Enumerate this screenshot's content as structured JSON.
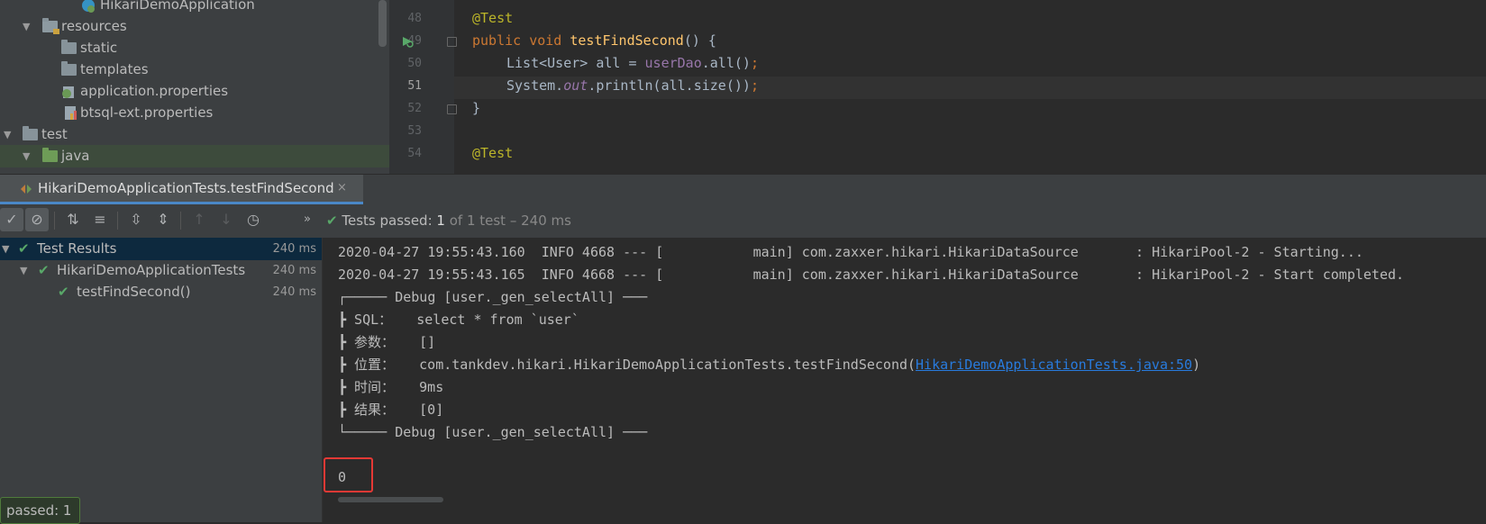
{
  "project_tree": {
    "items": [
      {
        "label": "HikariDemoApplication",
        "type": "class"
      },
      {
        "label": "resources",
        "type": "folder"
      },
      {
        "label": "static",
        "type": "folder"
      },
      {
        "label": "templates",
        "type": "folder"
      },
      {
        "label": "application.properties",
        "type": "file"
      },
      {
        "label": "btsql-ext.properties",
        "type": "file"
      },
      {
        "label": "test",
        "type": "folder"
      },
      {
        "label": "java",
        "type": "folder"
      }
    ]
  },
  "editor": {
    "line_numbers": [
      "48",
      "49",
      "50",
      "51",
      "52",
      "53",
      "54"
    ],
    "lines": {
      "l48_annotation": "@Test",
      "l49_public": "public",
      "l49_void": "void",
      "l49_method": "testFindSecond",
      "l49_rest": "() {",
      "l50_a": "List<User> all = ",
      "l50_field": "userDao",
      "l50_b": ".all()",
      "l50_semi": ";",
      "l51_a": "System.",
      "l51_out": "out",
      "l51_b": ".println(all.size())",
      "l51_semi": ";",
      "l52": "}",
      "l54_annotation": "@Test"
    }
  },
  "run_tab": {
    "label": "HikariDemoApplicationTests.testFindSecond",
    "close": "×"
  },
  "toolbar": {
    "status_prefix": "Tests passed: ",
    "status_count": "1",
    "status_suffix": " of 1 test – 240 ms"
  },
  "results": {
    "rows": [
      {
        "label": "Test Results",
        "time": "240 ms"
      },
      {
        "label": "HikariDemoApplicationTests",
        "time": "240 ms"
      },
      {
        "label": "testFindSecond()",
        "time": "240 ms"
      }
    ],
    "tooltip": "passed: 1"
  },
  "console": {
    "lines": [
      "2020-04-27 19:55:43.160  INFO 4668 --- [           main] com.zaxxer.hikari.HikariDataSource       : HikariPool-2 - Starting...",
      "2020-04-27 19:55:43.165  INFO 4668 --- [           main] com.zaxxer.hikari.HikariDataSource       : HikariPool-2 - Start completed.",
      "┌───── Debug [user._gen_selectAll] ───",
      "┣ SQL：   select * from `user`",
      "┣ 参数：   []",
      "┣ 位置：   com.tankdev.hikari.HikariDemoApplicationTests.testFindSecond(",
      "┣ 时间：   9ms",
      "┣ 结果：   [0]",
      "└───── Debug [user._gen_selectAll] ───"
    ],
    "link": "HikariDemoApplicationTests.java:50",
    "link_close": ")",
    "output": "0"
  },
  "colors": {
    "accent": "#4a88c7",
    "success": "#59a869",
    "highlight": "#e53935",
    "link": "#287bde"
  }
}
